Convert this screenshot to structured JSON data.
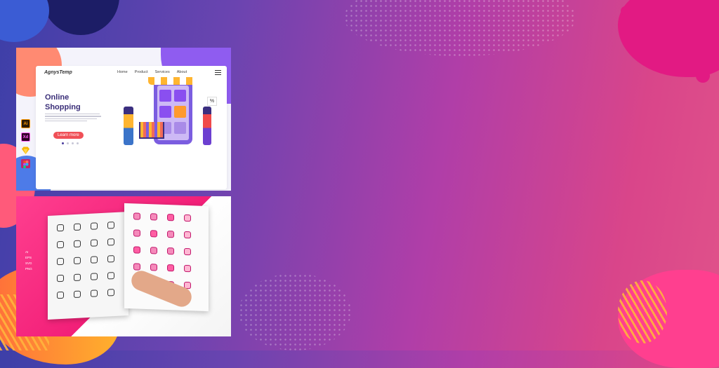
{
  "landing": {
    "logo": "AgnysTemp",
    "nav": [
      "Home",
      "Product",
      "Services",
      "About"
    ],
    "headline": "Online\nShopping",
    "cta": "Learn more",
    "tag": "%"
  },
  "tools": [
    {
      "label": "Ai",
      "icon": "illustrator-icon",
      "bg": "#2b1a07",
      "fg": "#ff9a00"
    },
    {
      "label": "Xd",
      "icon": "xd-icon",
      "bg": "#2e0024",
      "fg": "#ff61f6"
    },
    {
      "label": "",
      "icon": "sketch-icon",
      "bg": "#f7b500",
      "fg": "#ffffff"
    },
    {
      "label": "",
      "icon": "figma-icon",
      "bg": "#ffffff",
      "fg": "#a259ff"
    }
  ],
  "formats": "AI\nEPS\nSVG\nPNG",
  "colors": {
    "brand_purple": "#3a2e78",
    "cta_red": "#f05057",
    "pink": "#f21f78"
  }
}
